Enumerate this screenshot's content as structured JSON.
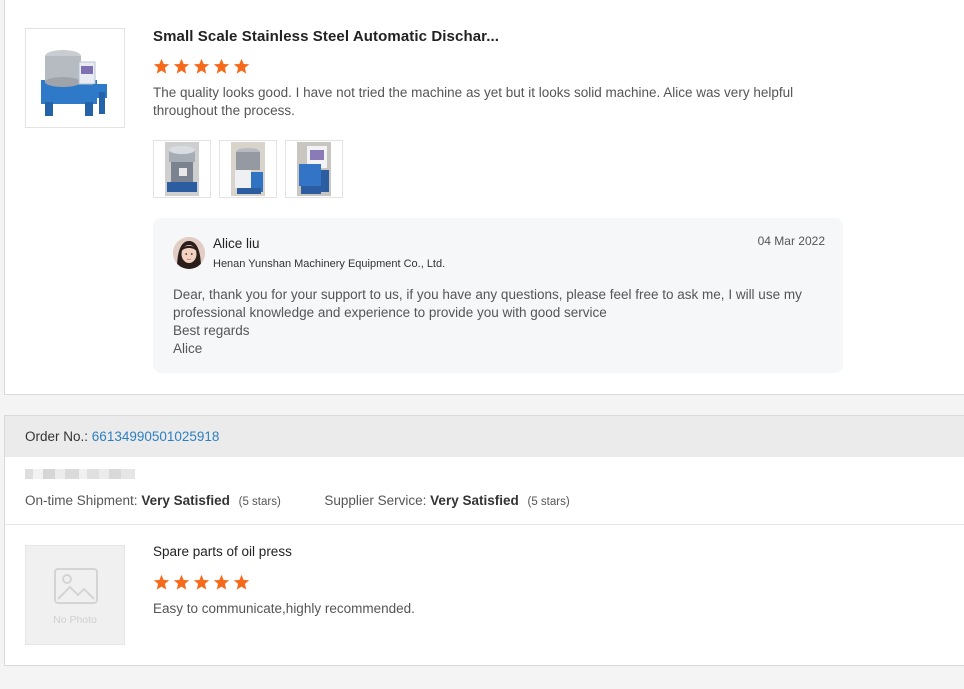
{
  "review1": {
    "product_title": "Small Scale Stainless Steel Automatic Dischar...",
    "rating": 5,
    "text": "The quality looks good. I have not tried the machine as yet but it looks solid machine. Alice was very helpful throughout the process.",
    "photo_count": 3,
    "reply": {
      "name": "Alice liu",
      "company": "Henan Yunshan Machinery Equipment Co., Ltd.",
      "date": "04 Mar 2022",
      "line1": "Dear, thank you for your support to us, if you have any questions, please feel free to ask me, I will use my professional knowledge and experience to provide you with good service",
      "line2": "Best regards",
      "line3": "Alice"
    }
  },
  "review2": {
    "order_label": "Order No.:",
    "order_number": "66134990501025918",
    "shipment_label": "On-time Shipment:",
    "shipment_value": "Very Satisfied",
    "shipment_stars": "(5 stars)",
    "service_label": "Supplier Service:",
    "service_value": "Very Satisfied",
    "service_stars": "(5 stars)",
    "no_photo_label": "No Photo",
    "product_title": "Spare parts of oil press",
    "rating": 5,
    "text": "Easy to communicate,highly recommended."
  },
  "colors": {
    "star": "#f76a1c",
    "link": "#2d7fc1"
  }
}
